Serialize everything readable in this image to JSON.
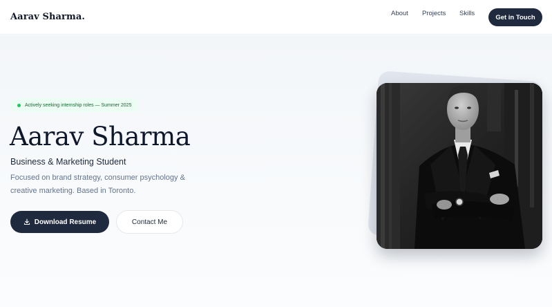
{
  "nav": {
    "brand": "Aarav Sharma.",
    "links": [
      "About",
      "Projects",
      "Skills"
    ],
    "cta_label": "Get in Touch"
  },
  "hero": {
    "status": "Actively seeking internship roles — Summer 2025",
    "title": "Aarav Sharma",
    "subtitle": "Business & Marketing Student",
    "description_line1": "Focused on brand strategy, consumer psychology &",
    "description_line2": "creative marketing. Based in Toronto.",
    "download_label": "Download Resume",
    "contact_label": "Contact Me"
  },
  "colors": {
    "primary": "#1f2a3e",
    "status_dot": "#22c55e",
    "status_bg": "#ecfdf3"
  },
  "icons": {
    "download": "download-icon",
    "status": "status-dot"
  }
}
